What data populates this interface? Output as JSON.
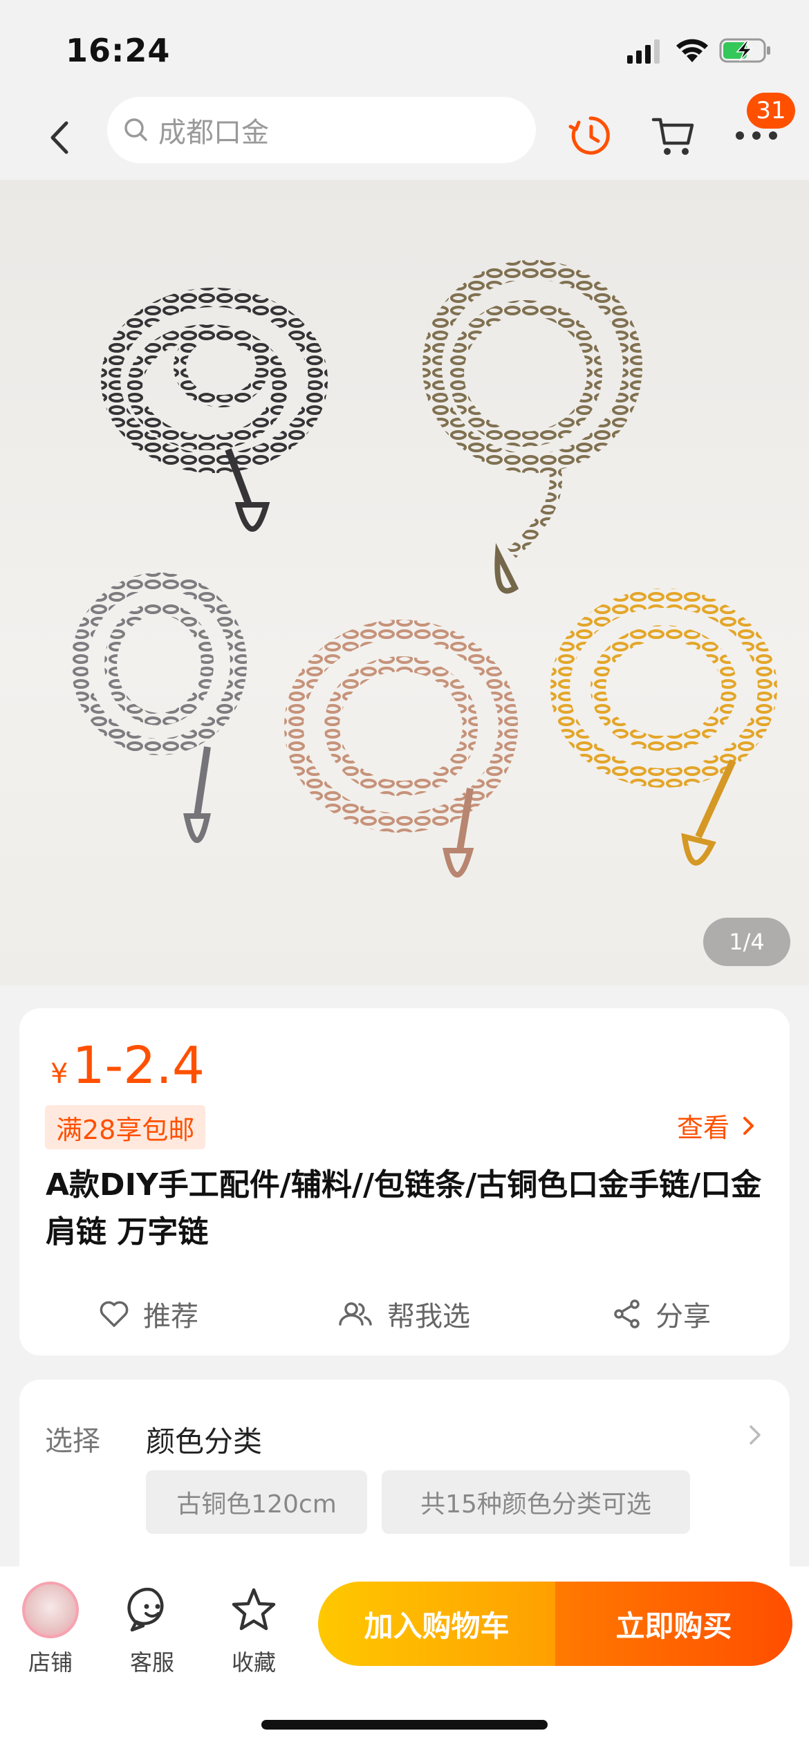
{
  "status_bar": {
    "time": "16:24"
  },
  "nav": {
    "search_placeholder": "成都口金",
    "badge_count": "31",
    "accent_color": "#ff5000"
  },
  "hero": {
    "image_counter": "1/4"
  },
  "product": {
    "currency": "¥",
    "price": "1-2.4",
    "promo_tag": "满28享包邮",
    "view_link": "查看",
    "title": "A款DIY手工配件/辅料//包链条/古铜色口金手链/口金肩链 万字链",
    "actions": {
      "recommend": "推荐",
      "help_choose": "帮我选",
      "share": "分享"
    }
  },
  "sku": {
    "label": "选择",
    "heading": "颜色分类",
    "chips": [
      "古铜色120cm",
      "共15种颜色分类可选"
    ]
  },
  "bottom_bar": {
    "shop": "店铺",
    "service": "客服",
    "favorite": "收藏",
    "add_to_cart": "加入购物车",
    "buy_now": "立即购买"
  }
}
